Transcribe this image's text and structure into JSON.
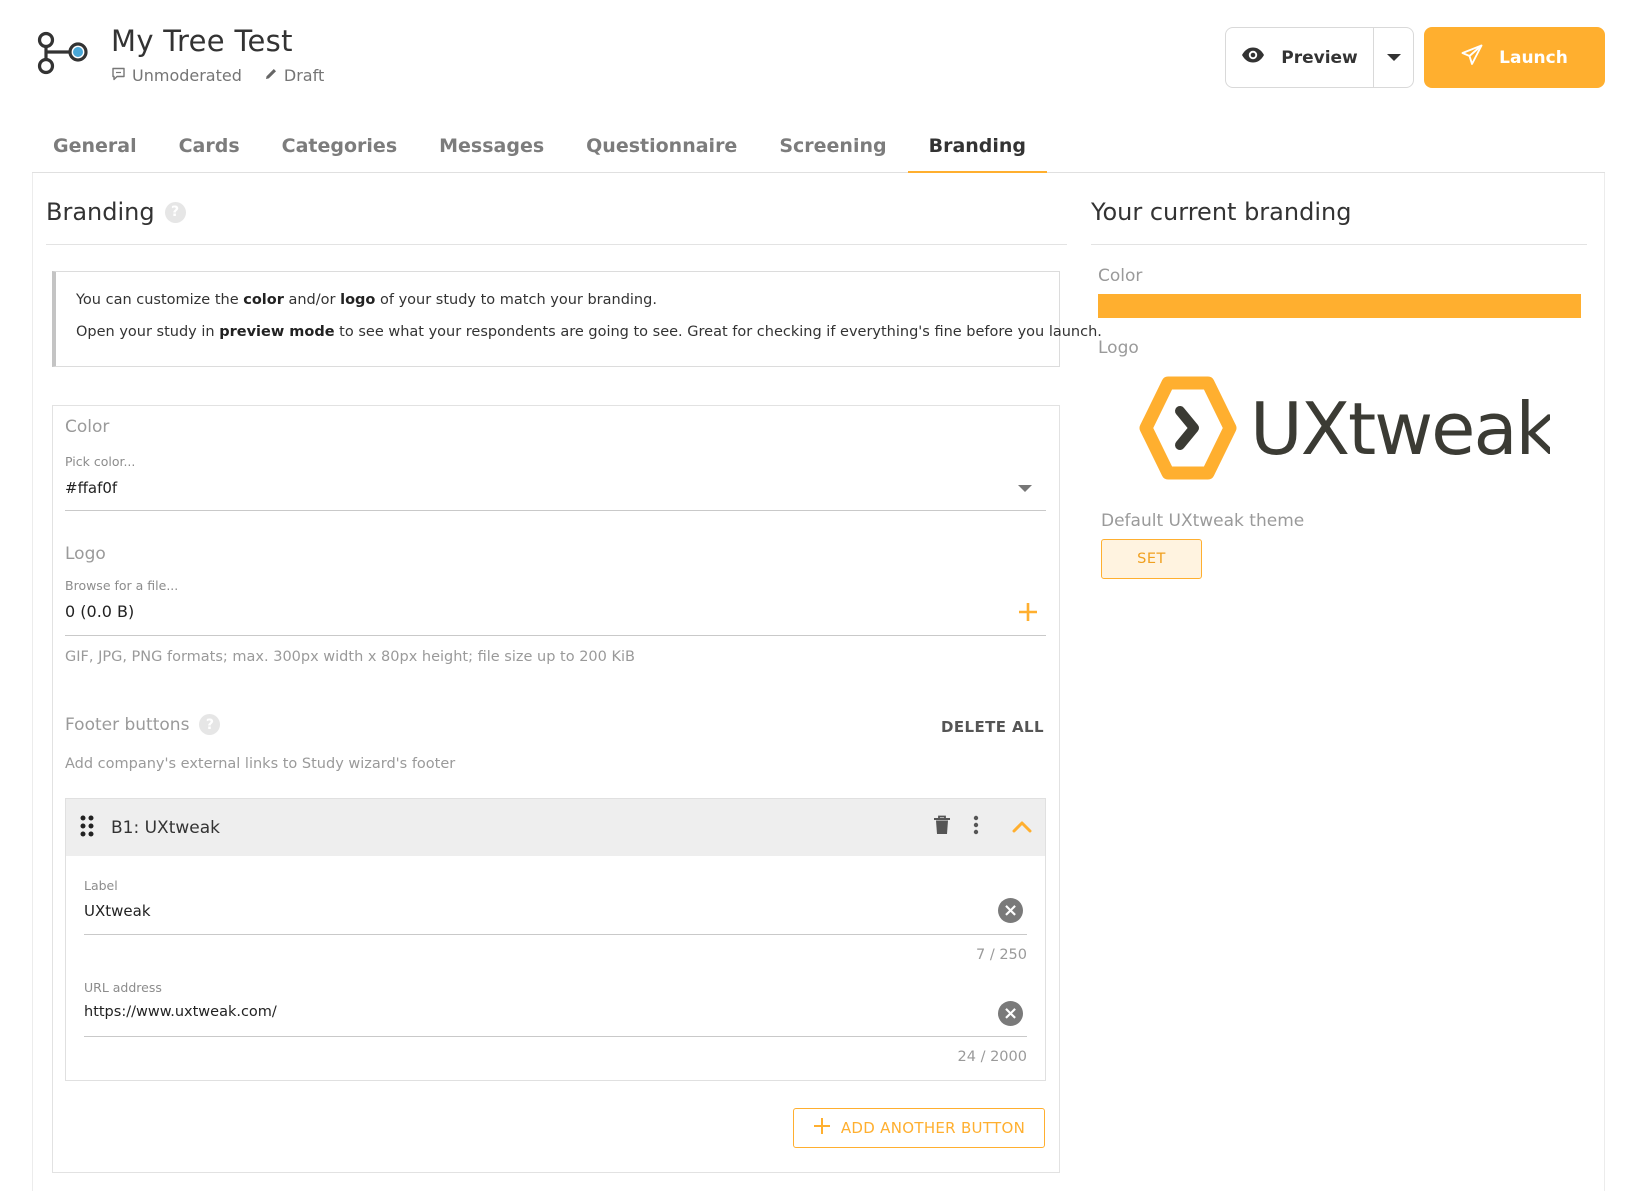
{
  "header": {
    "title": "My Tree Test",
    "mode": "Unmoderated",
    "status": "Draft",
    "preview_label": "Preview",
    "launch_label": "Launch",
    "icons": {
      "logo": "tree-test-icon",
      "mode": "chat-icon",
      "status": "pencil-icon",
      "preview": "eye-icon",
      "dropdown": "caret-down-icon",
      "launch": "paper-plane-icon"
    }
  },
  "tabs": [
    {
      "label": "General",
      "active": false
    },
    {
      "label": "Cards",
      "active": false
    },
    {
      "label": "Categories",
      "active": false
    },
    {
      "label": "Messages",
      "active": false
    },
    {
      "label": "Questionnaire",
      "active": false
    },
    {
      "label": "Screening",
      "active": false
    },
    {
      "label": "Branding",
      "active": true
    }
  ],
  "branding": {
    "title": "Branding",
    "help": "?",
    "info": {
      "line1_before": "You can customize the ",
      "line1_color": "color",
      "line1_mid": " and/or ",
      "line1_logo": "logo",
      "line1_after": " of your study to match your branding.",
      "line2_before": "Open your study in ",
      "line2_bold": "preview mode",
      "line2_after": " to see what your respondents are going to see. Great for checking if everything's fine before you launch."
    },
    "color": {
      "section_label": "Color",
      "field_label": "Pick color...",
      "value": "#ffaf0f"
    },
    "logo": {
      "section_label": "Logo",
      "field_label": "Browse for a file...",
      "value": "0 (0.0 B)",
      "hint": "GIF, JPG, PNG formats; max. 300px width x 80px height; file size up to 200 KiB"
    },
    "footer": {
      "section_label": "Footer buttons",
      "delete_all": "DELETE ALL",
      "hint": "Add company's external links to Study wizard's footer",
      "buttons": [
        {
          "title": "B1: UXtweak",
          "label_field": "Label",
          "label_value": "UXtweak",
          "label_counter": "7 / 250",
          "url_field": "URL address",
          "url_value": "https://www.uxtweak.com/",
          "url_counter": "24 / 2000"
        }
      ],
      "add_button": "ADD ANOTHER BUTTON"
    }
  },
  "current": {
    "title": "Your current branding",
    "color_label": "Color",
    "color_value": "#ffaf2f",
    "logo_label": "Logo",
    "logo_text": "UXtweak",
    "default_theme_label": "Default UXtweak theme",
    "set_label": "SET"
  },
  "colors": {
    "accent": "#ffaf2f",
    "text": "#333333",
    "muted": "#9a9a9a",
    "logo_dark": "#3b3b34"
  }
}
